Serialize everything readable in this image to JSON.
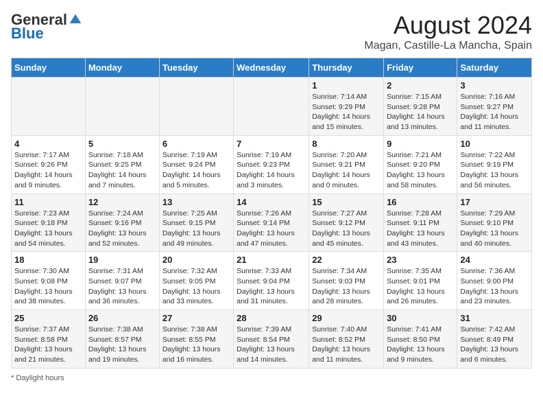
{
  "logo": {
    "general": "General",
    "blue": "Blue"
  },
  "title": {
    "month": "August 2024",
    "location": "Magan, Castille-La Mancha, Spain"
  },
  "weekdays": [
    "Sunday",
    "Monday",
    "Tuesday",
    "Wednesday",
    "Thursday",
    "Friday",
    "Saturday"
  ],
  "weeks": [
    [
      {
        "day": "",
        "info": ""
      },
      {
        "day": "",
        "info": ""
      },
      {
        "day": "",
        "info": ""
      },
      {
        "day": "",
        "info": ""
      },
      {
        "day": "1",
        "info": "Sunrise: 7:14 AM\nSunset: 9:29 PM\nDaylight: 14 hours and 15 minutes."
      },
      {
        "day": "2",
        "info": "Sunrise: 7:15 AM\nSunset: 9:28 PM\nDaylight: 14 hours and 13 minutes."
      },
      {
        "day": "3",
        "info": "Sunrise: 7:16 AM\nSunset: 9:27 PM\nDaylight: 14 hours and 11 minutes."
      }
    ],
    [
      {
        "day": "4",
        "info": "Sunrise: 7:17 AM\nSunset: 9:26 PM\nDaylight: 14 hours and 9 minutes."
      },
      {
        "day": "5",
        "info": "Sunrise: 7:18 AM\nSunset: 9:25 PM\nDaylight: 14 hours and 7 minutes."
      },
      {
        "day": "6",
        "info": "Sunrise: 7:19 AM\nSunset: 9:24 PM\nDaylight: 14 hours and 5 minutes."
      },
      {
        "day": "7",
        "info": "Sunrise: 7:19 AM\nSunset: 9:23 PM\nDaylight: 14 hours and 3 minutes."
      },
      {
        "day": "8",
        "info": "Sunrise: 7:20 AM\nSunset: 9:21 PM\nDaylight: 14 hours and 0 minutes."
      },
      {
        "day": "9",
        "info": "Sunrise: 7:21 AM\nSunset: 9:20 PM\nDaylight: 13 hours and 58 minutes."
      },
      {
        "day": "10",
        "info": "Sunrise: 7:22 AM\nSunset: 9:19 PM\nDaylight: 13 hours and 56 minutes."
      }
    ],
    [
      {
        "day": "11",
        "info": "Sunrise: 7:23 AM\nSunset: 9:18 PM\nDaylight: 13 hours and 54 minutes."
      },
      {
        "day": "12",
        "info": "Sunrise: 7:24 AM\nSunset: 9:16 PM\nDaylight: 13 hours and 52 minutes."
      },
      {
        "day": "13",
        "info": "Sunrise: 7:25 AM\nSunset: 9:15 PM\nDaylight: 13 hours and 49 minutes."
      },
      {
        "day": "14",
        "info": "Sunrise: 7:26 AM\nSunset: 9:14 PM\nDaylight: 13 hours and 47 minutes."
      },
      {
        "day": "15",
        "info": "Sunrise: 7:27 AM\nSunset: 9:12 PM\nDaylight: 13 hours and 45 minutes."
      },
      {
        "day": "16",
        "info": "Sunrise: 7:28 AM\nSunset: 9:11 PM\nDaylight: 13 hours and 43 minutes."
      },
      {
        "day": "17",
        "info": "Sunrise: 7:29 AM\nSunset: 9:10 PM\nDaylight: 13 hours and 40 minutes."
      }
    ],
    [
      {
        "day": "18",
        "info": "Sunrise: 7:30 AM\nSunset: 9:08 PM\nDaylight: 13 hours and 38 minutes."
      },
      {
        "day": "19",
        "info": "Sunrise: 7:31 AM\nSunset: 9:07 PM\nDaylight: 13 hours and 36 minutes."
      },
      {
        "day": "20",
        "info": "Sunrise: 7:32 AM\nSunset: 9:05 PM\nDaylight: 13 hours and 33 minutes."
      },
      {
        "day": "21",
        "info": "Sunrise: 7:33 AM\nSunset: 9:04 PM\nDaylight: 13 hours and 31 minutes."
      },
      {
        "day": "22",
        "info": "Sunrise: 7:34 AM\nSunset: 9:03 PM\nDaylight: 13 hours and 28 minutes."
      },
      {
        "day": "23",
        "info": "Sunrise: 7:35 AM\nSunset: 9:01 PM\nDaylight: 13 hours and 26 minutes."
      },
      {
        "day": "24",
        "info": "Sunrise: 7:36 AM\nSunset: 9:00 PM\nDaylight: 13 hours and 23 minutes."
      }
    ],
    [
      {
        "day": "25",
        "info": "Sunrise: 7:37 AM\nSunset: 8:58 PM\nDaylight: 13 hours and 21 minutes."
      },
      {
        "day": "26",
        "info": "Sunrise: 7:38 AM\nSunset: 8:57 PM\nDaylight: 13 hours and 19 minutes."
      },
      {
        "day": "27",
        "info": "Sunrise: 7:38 AM\nSunset: 8:55 PM\nDaylight: 13 hours and 16 minutes."
      },
      {
        "day": "28",
        "info": "Sunrise: 7:39 AM\nSunset: 8:54 PM\nDaylight: 13 hours and 14 minutes."
      },
      {
        "day": "29",
        "info": "Sunrise: 7:40 AM\nSunset: 8:52 PM\nDaylight: 13 hours and 11 minutes."
      },
      {
        "day": "30",
        "info": "Sunrise: 7:41 AM\nSunset: 8:50 PM\nDaylight: 13 hours and 9 minutes."
      },
      {
        "day": "31",
        "info": "Sunrise: 7:42 AM\nSunset: 8:49 PM\nDaylight: 13 hours and 6 minutes."
      }
    ]
  ],
  "footer": {
    "note": "Daylight hours"
  }
}
